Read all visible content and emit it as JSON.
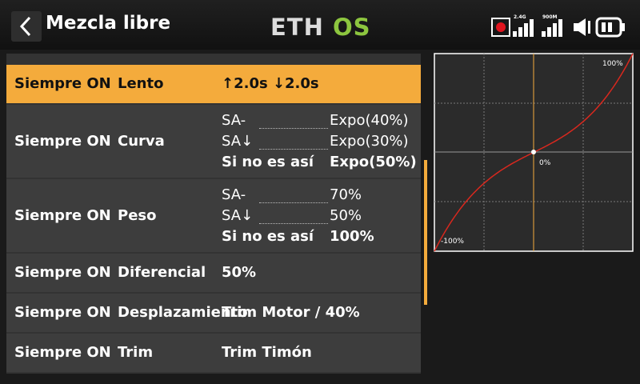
{
  "header": {
    "title": "Mezcla libre",
    "logo_left": "ETH",
    "logo_right": "OS",
    "status": {
      "rf_24g_label": "2.4G",
      "rf_900m_label": "900M",
      "record_icon": "record-dot-icon",
      "signal_icon": "signal-bars-icon",
      "volume_icon": "speaker-icon",
      "battery_icon": "battery-icon"
    }
  },
  "colors": {
    "accent": "#f4ab3c",
    "logo_green": "#8dc63f",
    "curve": "#d9281e",
    "record": "#e0141e"
  },
  "rows": [
    {
      "condition": "Siempre ON",
      "name": "Lento",
      "value": "↑2.0s ↓2.0s",
      "selected": true
    },
    {
      "condition": "Siempre ON",
      "name": "Curva",
      "lines": [
        {
          "label": "SA-",
          "value": "Expo(40%)"
        },
        {
          "label": "SA↓",
          "value": "Expo(30%)"
        },
        {
          "label": "Si no es así",
          "value": "Expo(50%)"
        }
      ]
    },
    {
      "condition": "Siempre ON",
      "name": "Peso",
      "lines": [
        {
          "label": "SA-",
          "value": "70%"
        },
        {
          "label": "SA↓",
          "value": "50%"
        },
        {
          "label": "Si no es así",
          "value": "100%"
        }
      ]
    },
    {
      "condition": "Siempre ON",
      "name": "Diferencial",
      "value": "50%"
    },
    {
      "condition": "Siempre ON",
      "name": "Desplazamiento",
      "value": "Trim Motor / 40%"
    },
    {
      "condition": "Siempre ON",
      "name": "Trim",
      "value": "Trim Timón"
    }
  ],
  "graph": {
    "label_top": "100%",
    "label_mid": "0%",
    "label_bottom": "-100%",
    "expo": 0.5
  }
}
